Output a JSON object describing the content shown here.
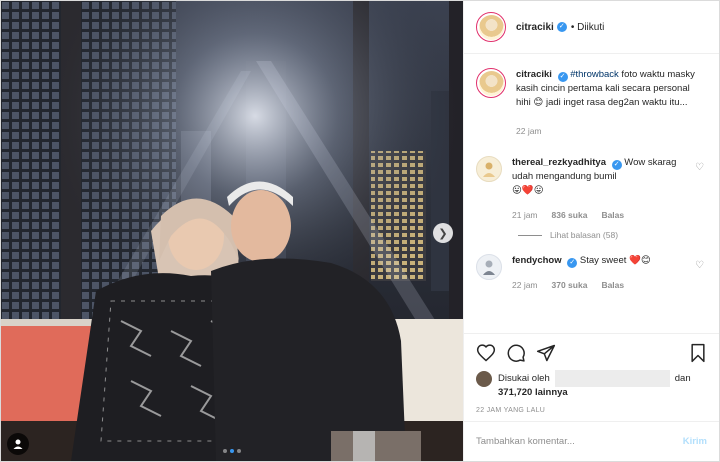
{
  "post": {
    "author": "citraciki",
    "follow_status": "• Diikuti"
  },
  "caption": {
    "username": "citraciki",
    "hashtag": "#throwback",
    "text": " foto waktu masky kasih cincin pertama kali secara personal hihi 😊 jadi inget rasa deg2an waktu itu...",
    "time": "22 jam"
  },
  "comments": [
    {
      "username": "thereal_rezkyadhitya",
      "text": " Wow skarag udah mengandung bumil",
      "emoji": "😛❤️😛",
      "time": "21 jam",
      "likes": "836 suka",
      "reply": "Balas",
      "view_replies": "Lihat balasan (58)"
    },
    {
      "username": "fendychow",
      "text": " Stay sweet ❤️😊",
      "time": "22 jam",
      "likes": "370 suka",
      "reply": "Balas"
    }
  ],
  "likes": {
    "prefix": "Disukai oleh",
    "suffix": "dan",
    "count": "371,720 lainnya"
  },
  "time_ago": "22 JAM YANG LALU",
  "add_comment": {
    "placeholder": "Tambahkan komentar...",
    "post_label": "Kirim"
  },
  "icons": {
    "like": "heart-icon",
    "comment": "comment-icon",
    "share": "share-icon",
    "save": "bookmark-icon",
    "next": "chevron-right-icon",
    "tag": "user-tag-icon"
  },
  "colors": {
    "link": "#003569",
    "verified": "#3897f0",
    "heart": "#ed4956",
    "muted": "#8e8e8e"
  },
  "carousel": {
    "slides": 3,
    "active_slide": 2
  }
}
